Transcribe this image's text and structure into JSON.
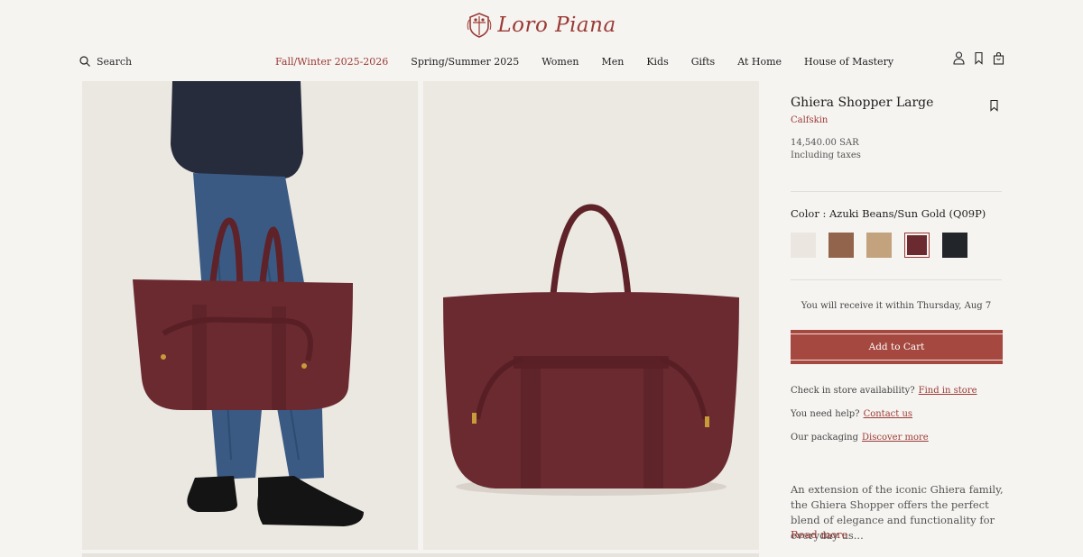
{
  "brand": {
    "name": "Loro Piana"
  },
  "search": {
    "label": "Search"
  },
  "nav": {
    "items": [
      {
        "label": "Fall/Winter 2025-2026"
      },
      {
        "label": "Spring/Summer 2025"
      },
      {
        "label": "Women"
      },
      {
        "label": "Men"
      },
      {
        "label": "Kids"
      },
      {
        "label": "Gifts"
      },
      {
        "label": "At Home"
      },
      {
        "label": "House of Mastery"
      }
    ],
    "active_color": "#9b3a35"
  },
  "product": {
    "title": "Ghiera Shopper Large",
    "material": "Calfskin",
    "price": "14,540.00 SAR",
    "taxes": "Including taxes",
    "color_label": "Color : Azuki Beans/Sun Gold (Q09P)",
    "swatches": [
      {
        "name": "ivory",
        "color": "#ebe6df"
      },
      {
        "name": "brown",
        "color": "#92644c"
      },
      {
        "name": "tan",
        "color": "#c3a37d"
      },
      {
        "name": "azuki-beans",
        "color": "#6b2a30",
        "selected": true
      },
      {
        "name": "black",
        "color": "#22252a"
      }
    ],
    "delivery": "You will receive it within Thursday, Aug 7",
    "add_to_cart": "Add to Cart",
    "store": {
      "text": "Check in store availability?",
      "link": "Find in store"
    },
    "help": {
      "text": "You need help?",
      "link": "Contact us"
    },
    "packaging": {
      "text": "Our packaging",
      "link": "Discover more"
    },
    "description": "An extension of the iconic Ghiera family, the Ghiera Shopper offers the perfect blend of elegance and functionality for everyday us...",
    "read_more": "Read more"
  },
  "colors": {
    "accent": "#9b3a35",
    "cart_button": "#a5483f",
    "bag": "#6b2a30"
  },
  "icons": [
    "search-icon",
    "account-icon",
    "bookmark-icon",
    "shopping-bag-icon",
    "wishlist-icon"
  ]
}
